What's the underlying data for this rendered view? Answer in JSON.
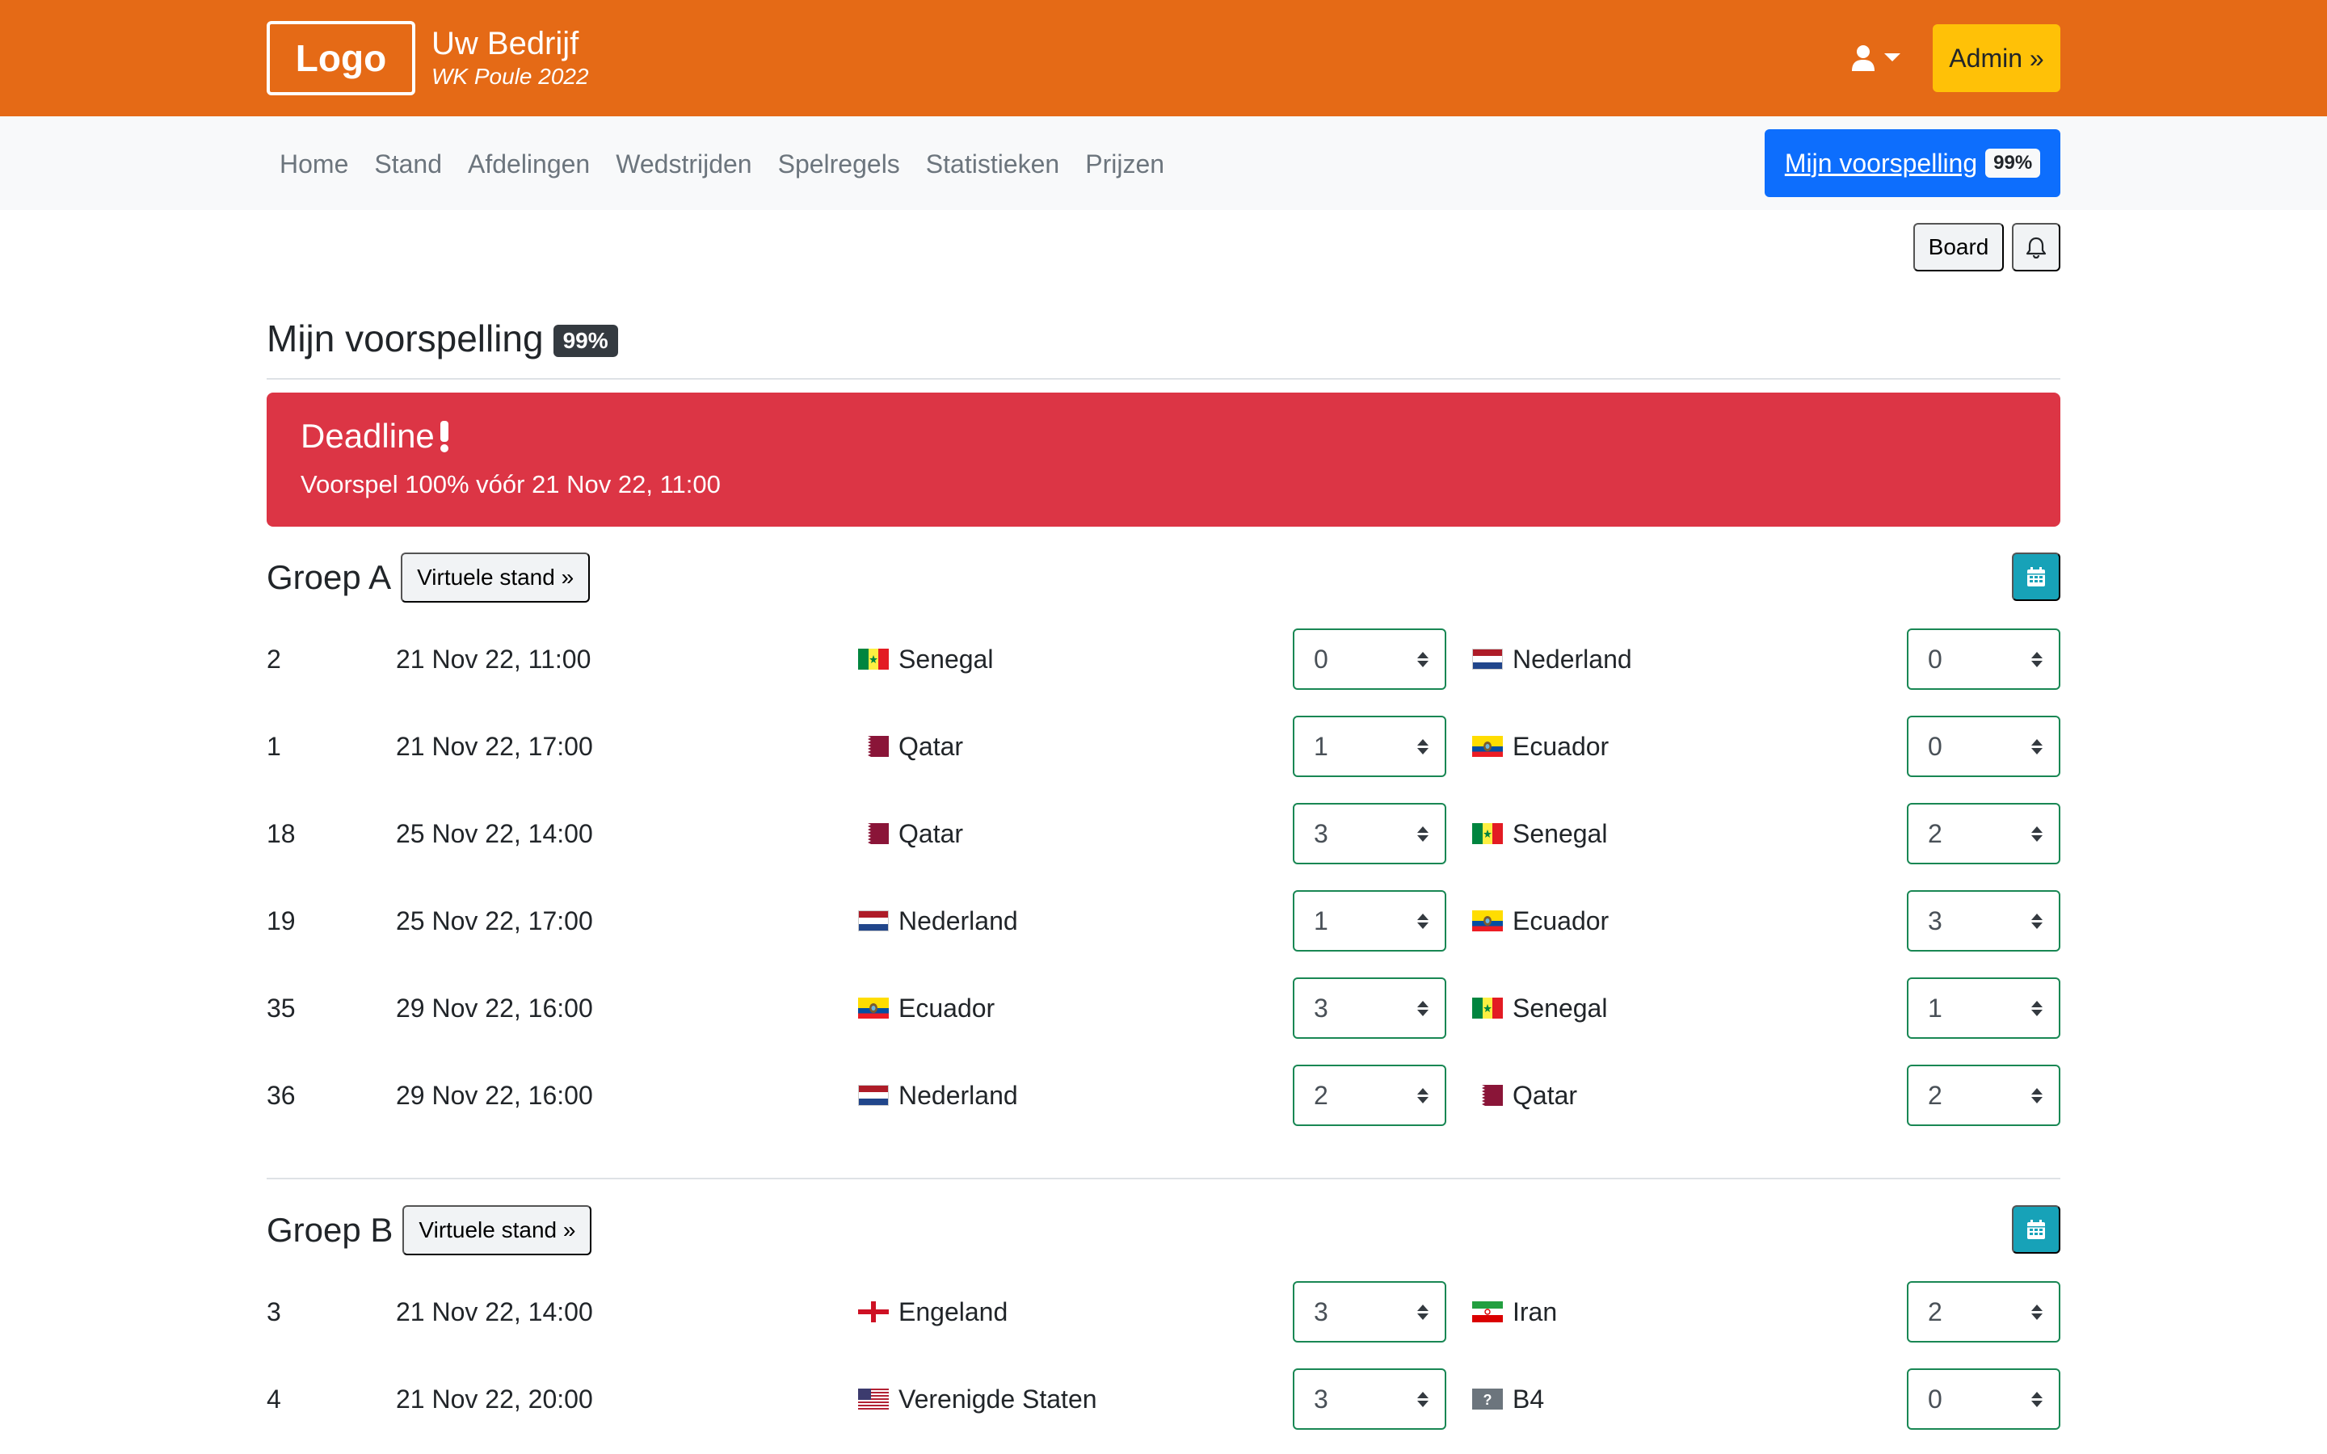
{
  "header": {
    "logo": "Logo",
    "company_name": "Uw Bedrijf",
    "company_sub": "WK Poule 2022",
    "admin_label": "Admin »",
    "user_icon": "user-icon"
  },
  "nav": {
    "items": [
      {
        "label": "Home"
      },
      {
        "label": "Stand"
      },
      {
        "label": "Afdelingen"
      },
      {
        "label": "Wedstrijden"
      },
      {
        "label": "Spelregels"
      },
      {
        "label": "Statistieken"
      },
      {
        "label": "Prijzen"
      }
    ],
    "prediction_button": {
      "label": "Mijn voorspelling",
      "badge": "99%"
    }
  },
  "toolbar": {
    "board_label": "Board",
    "bell_icon": "bell-icon"
  },
  "page": {
    "title": "Mijn voorspelling",
    "badge": "99%"
  },
  "alert": {
    "title": "Deadline",
    "icon": "exclamation-icon",
    "text": "Voorspel 100% vóór 21 Nov 22, 11:00"
  },
  "groups": [
    {
      "title": "Groep A",
      "virtual_label": "Virtuele stand »",
      "matches": [
        {
          "num": "2",
          "date": "21 Nov 22, 11:00",
          "home": "Senegal",
          "home_flag": "senegal",
          "home_score": "0",
          "away": "Nederland",
          "away_flag": "netherlands",
          "away_score": "0"
        },
        {
          "num": "1",
          "date": "21 Nov 22, 17:00",
          "home": "Qatar",
          "home_flag": "qatar",
          "home_score": "1",
          "away": "Ecuador",
          "away_flag": "ecuador",
          "away_score": "0"
        },
        {
          "num": "18",
          "date": "25 Nov 22, 14:00",
          "home": "Qatar",
          "home_flag": "qatar",
          "home_score": "3",
          "away": "Senegal",
          "away_flag": "senegal",
          "away_score": "2"
        },
        {
          "num": "19",
          "date": "25 Nov 22, 17:00",
          "home": "Nederland",
          "home_flag": "netherlands",
          "home_score": "1",
          "away": "Ecuador",
          "away_flag": "ecuador",
          "away_score": "3"
        },
        {
          "num": "35",
          "date": "29 Nov 22, 16:00",
          "home": "Ecuador",
          "home_flag": "ecuador",
          "home_score": "3",
          "away": "Senegal",
          "away_flag": "senegal",
          "away_score": "1"
        },
        {
          "num": "36",
          "date": "29 Nov 22, 16:00",
          "home": "Nederland",
          "home_flag": "netherlands",
          "home_score": "2",
          "away": "Qatar",
          "away_flag": "qatar",
          "away_score": "2"
        }
      ]
    },
    {
      "title": "Groep B",
      "virtual_label": "Virtuele stand »",
      "matches": [
        {
          "num": "3",
          "date": "21 Nov 22, 14:00",
          "home": "Engeland",
          "home_flag": "england",
          "home_score": "3",
          "away": "Iran",
          "away_flag": "iran",
          "away_score": "2"
        },
        {
          "num": "4",
          "date": "21 Nov 22, 20:00",
          "home": "Verenigde Staten",
          "home_flag": "usa",
          "home_score": "3",
          "away": "B4",
          "away_flag": "unknown",
          "away_score": "0"
        }
      ]
    }
  ],
  "colors": {
    "header_bg": "#e56a16",
    "admin_bg": "#ffc107",
    "primary": "#0d6efd",
    "danger": "#dc3545",
    "success_border": "#198754",
    "info": "#17a2b8"
  }
}
